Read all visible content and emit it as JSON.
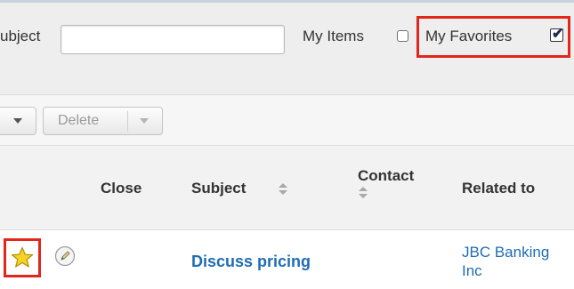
{
  "filters": {
    "subject_label": "ubject",
    "subject_input_value": "",
    "my_items_label": "My Items",
    "my_items_checked": false,
    "my_favorites_label": "My Favorites",
    "my_favorites_checked": true,
    "checkmark_glyph": "✔"
  },
  "toolbar": {
    "delete_label": "Delete"
  },
  "table": {
    "headers": {
      "close": "Close",
      "subject": "Subject",
      "contact": "Contact",
      "related_to": "Related to"
    },
    "rows": [
      {
        "favorite": true,
        "subject": "Discuss pricing",
        "related_to": "JBC Banking Inc"
      }
    ]
  },
  "colors": {
    "highlight": "#e1261c",
    "link": "#1f6db3",
    "star": "#f5d327"
  },
  "icons": {
    "favorite": "star-icon",
    "edit": "pencil-icon",
    "sort": "sort-arrows-icon",
    "dropdown": "caret-down-icon"
  }
}
